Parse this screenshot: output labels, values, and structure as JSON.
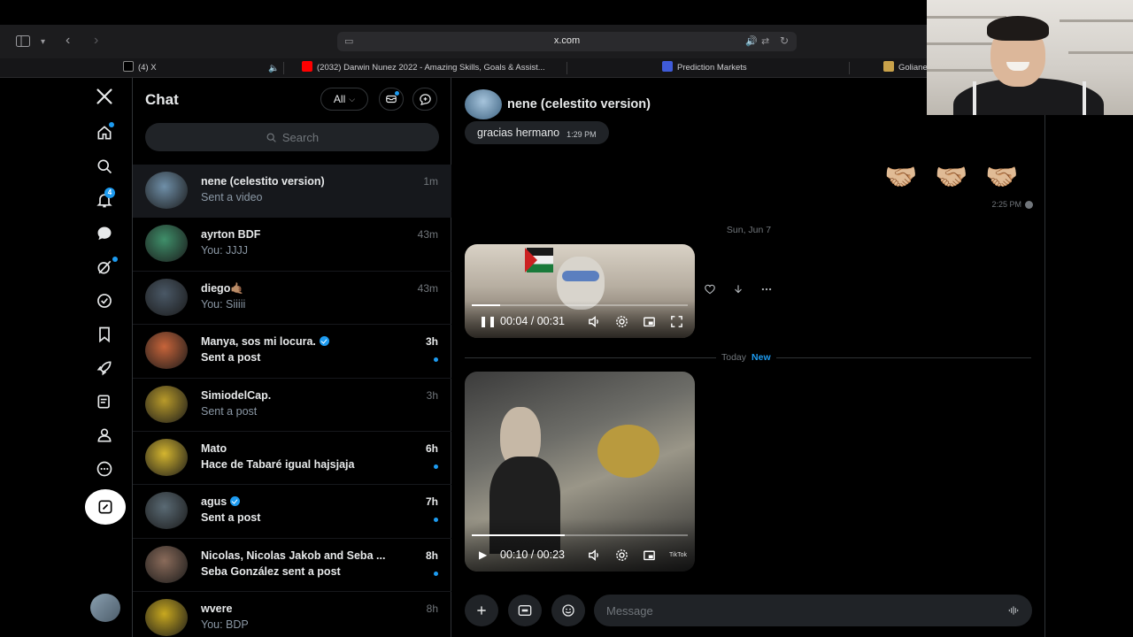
{
  "browser": {
    "url": "x.com",
    "tabs": [
      {
        "label": "(4) X",
        "color": "#ffffff"
      },
      {
        "label": "(2032) Darwin Nunez 2022 - Amazing Skills, Goals & Assist...",
        "color": "#ff0000"
      },
      {
        "label": "Prediction Markets",
        "color": "#3f5bd8"
      },
      {
        "label": "Goliane",
        "color": "#c9a24a"
      }
    ]
  },
  "nav": {
    "notifications_badge": "4"
  },
  "list": {
    "title": "Chat",
    "filter_label": "All",
    "search_placeholder": "Search",
    "rows": [
      {
        "name": "nene (celestito version)",
        "sub": "Sent a video",
        "time": "1m",
        "verified": false,
        "unread": false,
        "active": true,
        "avatar": "#6f8fa8"
      },
      {
        "name": "ayrton BDF",
        "sub": "You: JJJJ",
        "time": "43m",
        "verified": false,
        "unread": false,
        "active": false,
        "avatar": "#3f8f6a"
      },
      {
        "name": "diego🤙🏽",
        "sub": "You: Siiiii",
        "time": "43m",
        "verified": false,
        "unread": false,
        "active": false,
        "avatar": "#4a5866"
      },
      {
        "name": "Manya, sos mi locura.",
        "sub": "Sent a post",
        "time": "3h",
        "verified": true,
        "unread": true,
        "active": false,
        "avatar": "#c7643a"
      },
      {
        "name": "SimiodelCap.",
        "sub": "Sent a post",
        "time": "3h",
        "verified": false,
        "unread": false,
        "active": false,
        "avatar": "#b89a2a"
      },
      {
        "name": "Mato",
        "sub": "Hace de Tabaré igual hajsjaja",
        "time": "6h",
        "verified": false,
        "unread": true,
        "active": false,
        "avatar": "#d4b52f"
      },
      {
        "name": "agus",
        "sub": "Sent a post",
        "time": "7h",
        "verified": true,
        "unread": true,
        "active": false,
        "avatar": "#5a6a74"
      },
      {
        "name": "Nicolas, Nicolas Jakob and Seba ...",
        "sub": "Seba González sent a post",
        "time": "8h",
        "verified": false,
        "unread": true,
        "active": false,
        "avatar": "#8a6b5a"
      },
      {
        "name": "wvere",
        "sub": "You: BDP",
        "time": "8h",
        "verified": false,
        "unread": false,
        "active": false,
        "avatar": "#c8a81f"
      }
    ]
  },
  "convo": {
    "name": "nene (celestito version)",
    "incoming_text": "gracias hermano",
    "incoming_time": "1:29 PM",
    "emoji": [
      "🤝🏼",
      "🤝🏼",
      "🤝🏼"
    ],
    "sent_time": "2:25 PM",
    "day_label": "Sun, Jun 7",
    "today_label": "Today",
    "new_label": "New",
    "video1": {
      "time": "00:04 / 00:31",
      "progress": 0.13
    },
    "video2": {
      "time": "00:10 / 00:23",
      "progress": 0.43,
      "watermark": "TikTok"
    },
    "message_placeholder": "Message"
  }
}
